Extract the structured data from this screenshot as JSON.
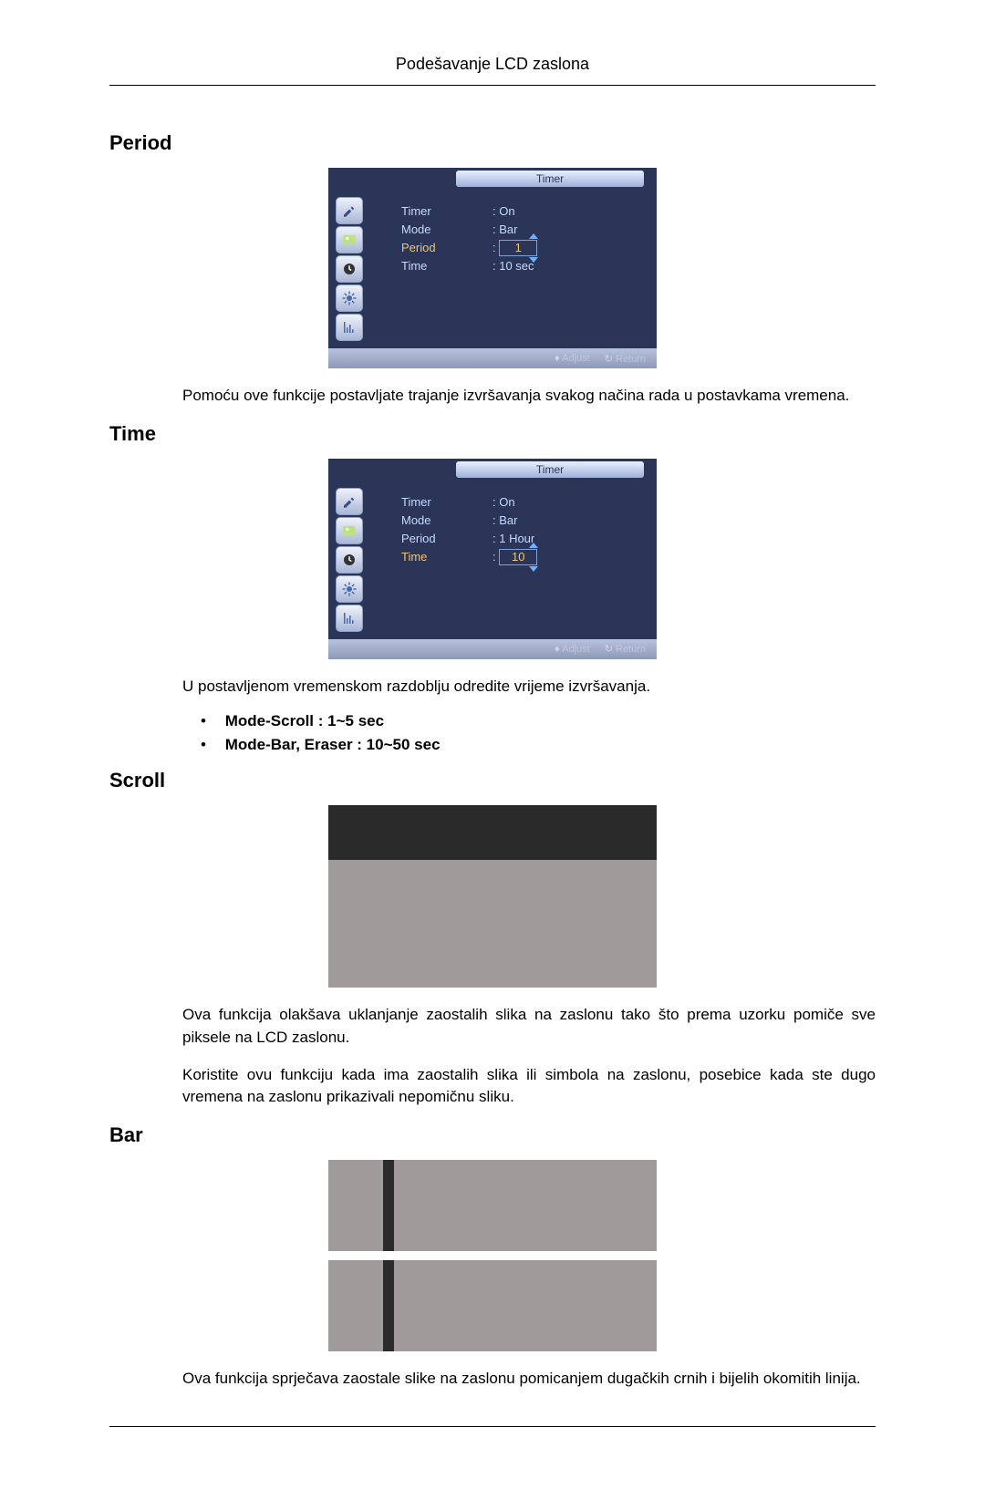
{
  "page_title": "Podešavanje LCD zaslona",
  "sections": {
    "period": {
      "title": "Period",
      "text": "Pomoću ove funkcije postavljate trajanje izvršavanja svakog načina rada u postavkama vremena."
    },
    "time": {
      "title": "Time",
      "text": "U postavljenom vremenskom razdoblju odredite vrijeme izvršavanja.",
      "bullets": [
        {
          "label": "Mode-Scroll",
          "value_text": " : 1~5 sec"
        },
        {
          "label": "Mode-Bar, Eraser",
          "value_text": " : 10~50 sec"
        }
      ]
    },
    "scroll": {
      "title": "Scroll",
      "text1": "Ova funkcija olakšava uklanjanje zaostalih slika na zaslonu tako što prema uzorku pomiče sve piksele na LCD zaslonu.",
      "text2": "Koristite ovu funkciju kada ima zaostalih slika ili simbola na zaslonu, posebice kada ste dugo vremena na zaslonu prikazivali nepomičnu sliku."
    },
    "bar": {
      "title": "Bar",
      "text": "Ova funkcija sprječava zaostale slike na zaslonu pomicanjem dugačkih crnih i bijelih okomitih linija."
    }
  },
  "osd_period": {
    "title": "Timer",
    "rows": [
      {
        "label": "Timer",
        "value": ": On"
      },
      {
        "label": "Mode",
        "value": ": Bar"
      },
      {
        "label": "Period",
        "value": "1",
        "boxed": true,
        "highlighted": true,
        "prefix": ": "
      },
      {
        "label": "Time",
        "value": ": 10 sec"
      }
    ],
    "footer": {
      "adjust": "Adjust",
      "return": "Return"
    }
  },
  "osd_time": {
    "title": "Timer",
    "rows": [
      {
        "label": "Timer",
        "value": ": On"
      },
      {
        "label": "Mode",
        "value": ": Bar"
      },
      {
        "label": "Period",
        "value": ": 1 Hour"
      },
      {
        "label": "Time",
        "value": "10",
        "boxed": true,
        "highlighted": true,
        "prefix": ": "
      }
    ],
    "footer": {
      "adjust": "Adjust",
      "return": "Return"
    }
  },
  "icons": [
    "brush-icon",
    "picture-icon",
    "clock-icon",
    "gear-icon",
    "chart-icon"
  ]
}
